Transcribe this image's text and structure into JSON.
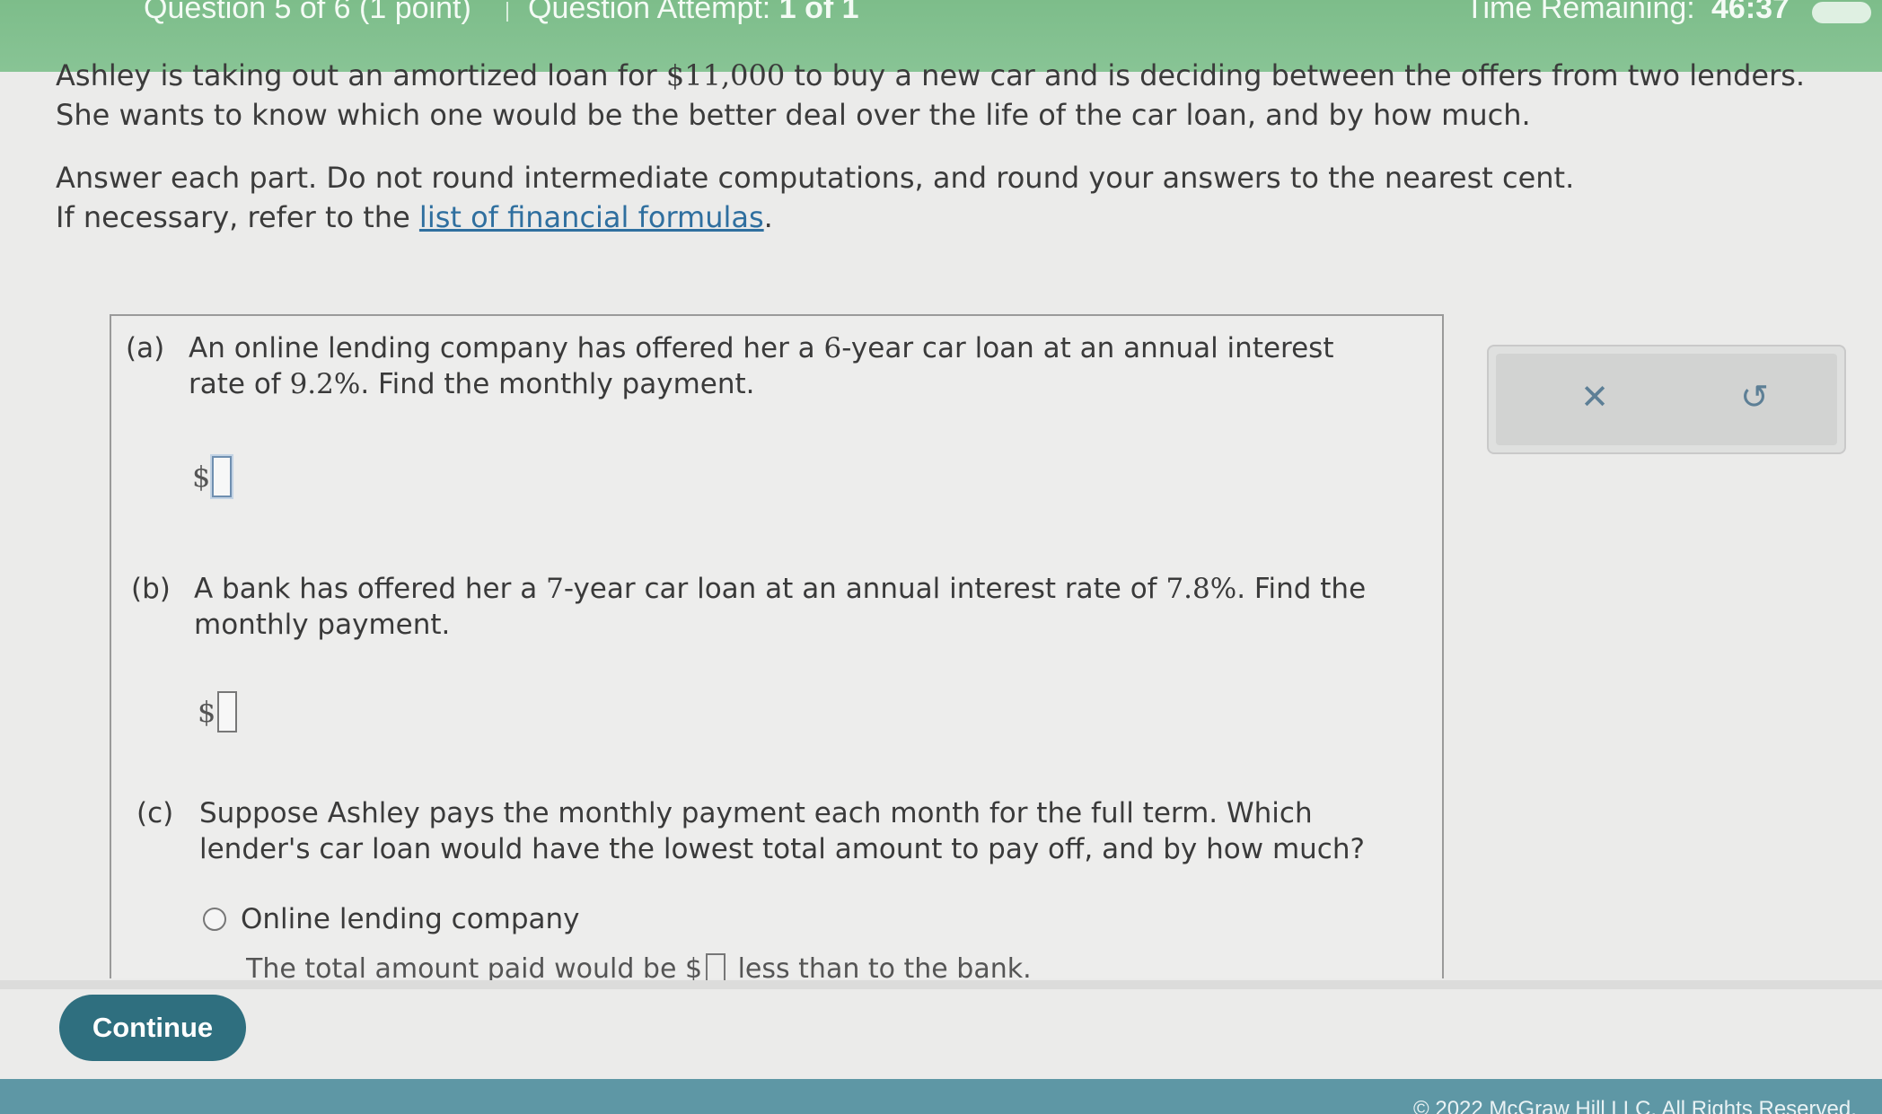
{
  "header": {
    "question_info": "Question 5 of 6 (1 point)",
    "attempt_label": "Question Attempt:",
    "attempt_value": "1 of 1",
    "time_label": "Time Remaining:",
    "time_value": "46:37"
  },
  "intro": {
    "line1_pre": "Ashley is taking out an amortized loan for ",
    "loan_amount": "$11,000",
    "line1_post": " to buy a new car and is deciding between the offers from two lenders.",
    "line2": "She wants to know which one would be the better deal over the life of the car loan, and by how much.",
    "instructions": "Answer each part. Do not round intermediate computations, and round your answers to the nearest cent.",
    "refer_pre": "If necessary, refer to the ",
    "refer_link": "list of financial formulas",
    "refer_post": "."
  },
  "parts": {
    "a": {
      "label": "(a)",
      "text_pre": "An online lending company has offered her a ",
      "years": "6",
      "text_mid": "-year car loan at an annual interest rate of ",
      "rate": "9.2%",
      "text_post": ". Find the monthly payment.",
      "currency": "$"
    },
    "b": {
      "label": "(b)",
      "text_pre": "A bank has offered her a ",
      "years": "7",
      "text_mid": "-year car loan at an annual interest rate of ",
      "rate": "7.8%",
      "text_post": ". Find the monthly payment.",
      "currency": "$"
    },
    "c": {
      "label": "(c)",
      "text": "Suppose Ashley pays the monthly payment each month for the full term. Which lender's car loan would have the lowest total amount to pay off, and by how much?",
      "option1": "Online lending company",
      "option1_detail_pre": "The total amount paid would be $",
      "option1_detail_post": " less than to the bank."
    }
  },
  "tools": {
    "clear_symbol": "✕",
    "undo_symbol": "↺"
  },
  "continue_label": "Continue",
  "footer": {
    "copyright": "© 2022 McGraw Hill LLC. All Rights Reserved."
  }
}
